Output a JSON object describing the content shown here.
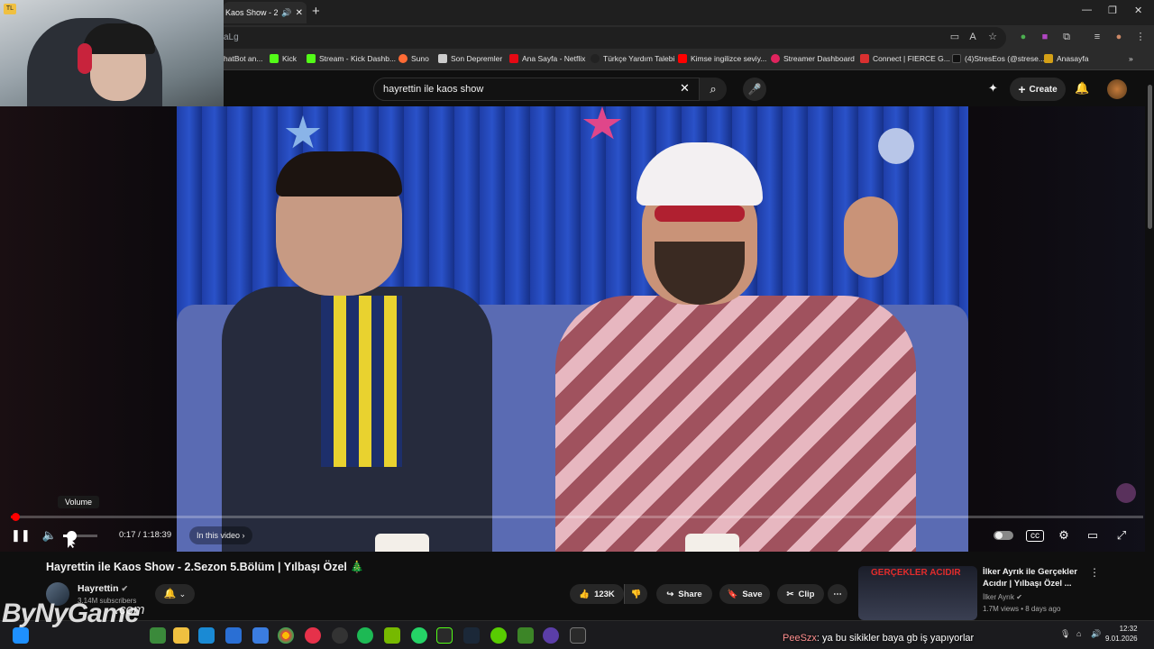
{
  "browser": {
    "tab_title": "Kaos Show - 2",
    "url_fragment": "aLg",
    "bookmarks": [
      {
        "label": "hatBot an...",
        "color": "#9aa0a6"
      },
      {
        "label": "Kick",
        "color": "#53fc18"
      },
      {
        "label": "Stream - Kick Dashb...",
        "color": "#53fc18"
      },
      {
        "label": "Suno",
        "color": "#ff6b35"
      },
      {
        "label": "Son Depremler",
        "color": "#cccccc"
      },
      {
        "label": "Ana Sayfa - Netflix",
        "color": "#e50914"
      },
      {
        "label": "Türkçe Yardım Talebi",
        "color": "#222222"
      },
      {
        "label": "Kimse ingilizce seviy...",
        "color": "#ff0000"
      },
      {
        "label": "Streamer Dashboard",
        "color": "#e0245e"
      },
      {
        "label": "Connect | FIERCE G...",
        "color": "#d93030"
      },
      {
        "label": "(4)StresEos (@strese...",
        "color": "#111111"
      },
      {
        "label": "Anasayfa",
        "color": "#d4a017"
      }
    ]
  },
  "youtube": {
    "search_value": "hayrettin ile kaos show",
    "create_label": "Create"
  },
  "player": {
    "volume_tooltip": "Volume",
    "time_display": "0:17 / 1:18:39",
    "chapter_label": "In this video",
    "progress_fraction": 0.0036,
    "volume_fraction": 0.25
  },
  "video": {
    "title": "Hayrettin ile Kaos Show - 2.Sezon 5.Bölüm | Yılbaşı Özel 🎄",
    "channel_name": "Hayrettin",
    "subscribers": "3.14M subscribers",
    "likes": "123K",
    "share_label": "Share",
    "save_label": "Save",
    "clip_label": "Clip"
  },
  "related": {
    "thumb_text": "GERÇEKLER ACIDIR",
    "title": "İlker Ayrık ile Gerçekler Acıdır | Yılbaşı Özel ...",
    "channel": "İlker Ayrık",
    "meta": "1.7M views • 8 days ago"
  },
  "stream_overlay": {
    "watermark": "ByNyGame",
    "watermark_suffix": ".com",
    "chat_user": "PeeSzx",
    "chat_message": ": ya bu sikikler baya gb iş yapıyorlar"
  },
  "taskbar": {
    "time": "12:32",
    "date": "9.01.2026"
  },
  "colors": {
    "accent": "#ff0000",
    "background": "#0f0f0f"
  }
}
